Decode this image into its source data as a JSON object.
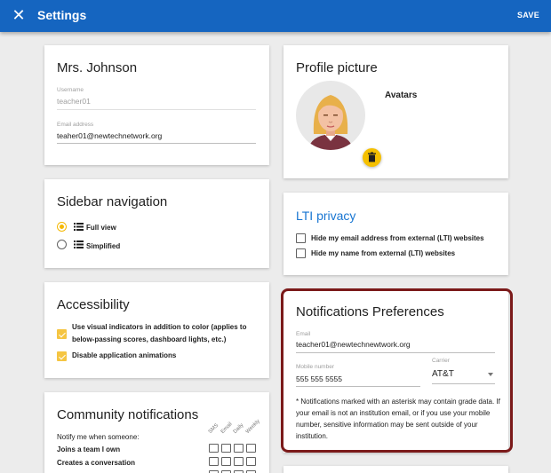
{
  "header": {
    "title": "Settings",
    "save_label": "SAVE"
  },
  "account": {
    "name": "Mrs. Johnson",
    "username_label": "Username",
    "username_value": "teacher01",
    "email_label": "Email address",
    "email_value": "teaher01@newtechnetwork.org"
  },
  "sidebar_nav": {
    "title": "Sidebar navigation",
    "options": [
      {
        "label": "Full view",
        "checked": true
      },
      {
        "label": "Simplified",
        "checked": false
      }
    ]
  },
  "accessibility": {
    "title": "Accessibility",
    "options": [
      {
        "label": "Use visual indicators in addition to color (applies to below-passing scores, dashboard lights, etc.)",
        "checked": true
      },
      {
        "label": "Disable application animations",
        "checked": true
      }
    ]
  },
  "community": {
    "title": "Community notifications",
    "intro": "Notify me when someone:",
    "columns": [
      "SMS",
      "Email",
      "Daily",
      "Weekly"
    ],
    "rows": [
      "Joins a team I own",
      "Creates a conversation"
    ]
  },
  "profile": {
    "title": "Profile picture",
    "avatars_label": "Avatars"
  },
  "lti": {
    "title": "LTI privacy",
    "options": [
      {
        "label": "Hide my email address from external (LTI) websites",
        "checked": false
      },
      {
        "label": "Hide my name from external (LTI) websites",
        "checked": false
      }
    ]
  },
  "notifications": {
    "title": "Notifications Preferences",
    "email_label": "Email",
    "email_value": "teacher01@newtechnewtwork.org",
    "mobile_label": "Mobile number",
    "mobile_value": "555 555 5555",
    "carrier_label": "Carrier",
    "carrier_value": "AT&T",
    "note": "* Notifications marked with an asterisk may contain grade data. If your email is not an institution email, or if you use your mobile number, sensitive information may be sent outside of your institution."
  },
  "colors": {
    "topbar": "#1565c0",
    "accent": "#f5c000",
    "link": "#1976d2",
    "highlight": "#7b1a1a"
  }
}
